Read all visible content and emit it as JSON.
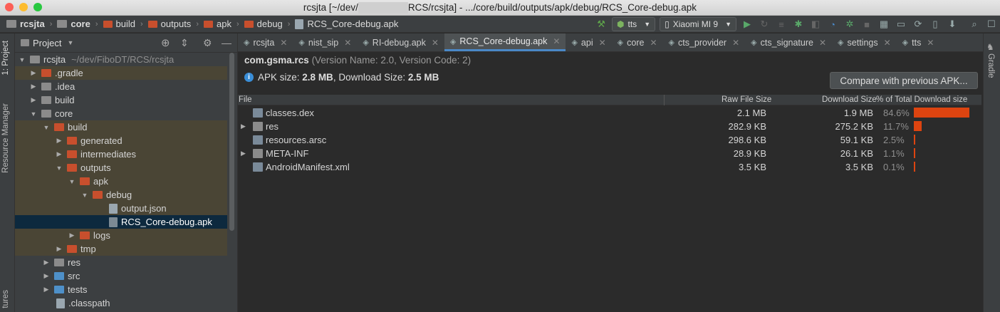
{
  "window": {
    "title_left": "rcsjta [~/dev/",
    "title_right": "RCS/rcsjta] - .../core/build/outputs/apk/debug/RCS_Core-debug.apk"
  },
  "breadcrumbs": [
    "rcsjta",
    "core",
    "build",
    "outputs",
    "apk",
    "debug",
    "RCS_Core-debug.apk"
  ],
  "toolbar": {
    "run_config": "tts",
    "device": "Xiaomi MI 9"
  },
  "left_strip": {
    "project_tab": "1: Project",
    "resource_tab": "Resource Manager",
    "structure_tab": "tures"
  },
  "right_strip": {
    "gradle_tab": "Gradle"
  },
  "project_panel": {
    "view_selector": "Project",
    "tree": [
      {
        "label": "rcsjta",
        "extra": "~/dev/FiboDT/RCS/rcsjta"
      },
      {
        "label": ".gradle"
      },
      {
        "label": ".idea"
      },
      {
        "label": "build"
      },
      {
        "label": "core"
      },
      {
        "label": "build"
      },
      {
        "label": "generated"
      },
      {
        "label": "intermediates"
      },
      {
        "label": "outputs"
      },
      {
        "label": "apk"
      },
      {
        "label": "debug"
      },
      {
        "label": "output.json"
      },
      {
        "label": "RCS_Core-debug.apk"
      },
      {
        "label": "logs"
      },
      {
        "label": "tmp"
      },
      {
        "label": "res"
      },
      {
        "label": "src"
      },
      {
        "label": "tests"
      },
      {
        "label": ".classpath"
      }
    ]
  },
  "editor": {
    "tabs": [
      "rcsjta",
      "nist_sip",
      "RI-debug.apk",
      "RCS_Core-debug.apk",
      "api",
      "core",
      "cts_provider",
      "cts_signature",
      "settings",
      "tts"
    ],
    "active_tab": "RCS_Core-debug.apk",
    "package_name": "com.gsma.rcs",
    "version_info": "(Version Name: 2.0, Version Code: 2)",
    "apk_size_label": "APK size:",
    "apk_size": "2.8 MB",
    "download_size_label": ", Download Size:",
    "download_size": "2.5 MB",
    "compare_button": "Compare with previous APK...",
    "columns": {
      "file": "File",
      "raw": "Raw File Size",
      "download": "Download Size",
      "percent": "% of Total Download size"
    },
    "rows": [
      {
        "name": "classes.dex",
        "raw": "2.1 MB",
        "download": "1.9 MB",
        "percent": "84.6%",
        "fraction": 0.846
      },
      {
        "name": "res",
        "raw": "282.9 KB",
        "download": "275.2 KB",
        "percent": "11.7%",
        "fraction": 0.117
      },
      {
        "name": "resources.arsc",
        "raw": "298.6 KB",
        "download": "59.1 KB",
        "percent": "2.5%",
        "fraction": 0.025
      },
      {
        "name": "META-INF",
        "raw": "28.9 KB",
        "download": "26.1 KB",
        "percent": "1.1%",
        "fraction": 0.011
      },
      {
        "name": "AndroidManifest.xml",
        "raw": "3.5 KB",
        "download": "3.5 KB",
        "percent": "0.1%",
        "fraction": 0.001
      }
    ]
  },
  "colors": {
    "accent": "#4a88c7",
    "bar": "#dd4410",
    "folder": "#c84f2d",
    "selection": "#0d293e"
  }
}
